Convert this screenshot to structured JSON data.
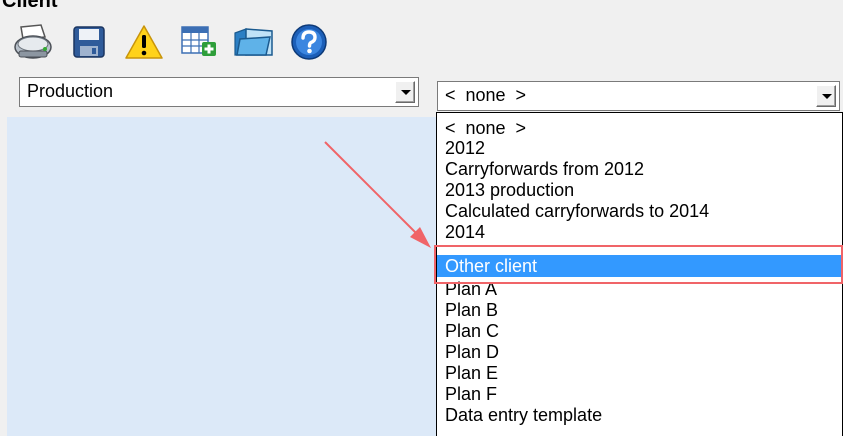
{
  "window": {
    "title": "Client"
  },
  "toolbar": {
    "buttons": [
      {
        "icon": "printer-icon"
      },
      {
        "icon": "save-icon"
      },
      {
        "icon": "warning-icon"
      },
      {
        "icon": "add-table-icon"
      },
      {
        "icon": "folder-icon"
      },
      {
        "icon": "help-icon"
      }
    ]
  },
  "left_combo": {
    "value": "Production"
  },
  "right_combo": {
    "value": "<  none  >"
  },
  "dropdown": {
    "items": [
      "<  none  >",
      "2012",
      "Carryforwards from 2012",
      "2013 production",
      "Calculated carryforwards to 2014",
      "2014",
      "Other client",
      "Plan A",
      "Plan B",
      "Plan C",
      "Plan D",
      "Plan E",
      "Plan F",
      "Data entry template"
    ],
    "selected_index": 6
  },
  "colors": {
    "selection": "#3399ff",
    "panel": "#dce9f8",
    "annotation": "#f06468"
  }
}
